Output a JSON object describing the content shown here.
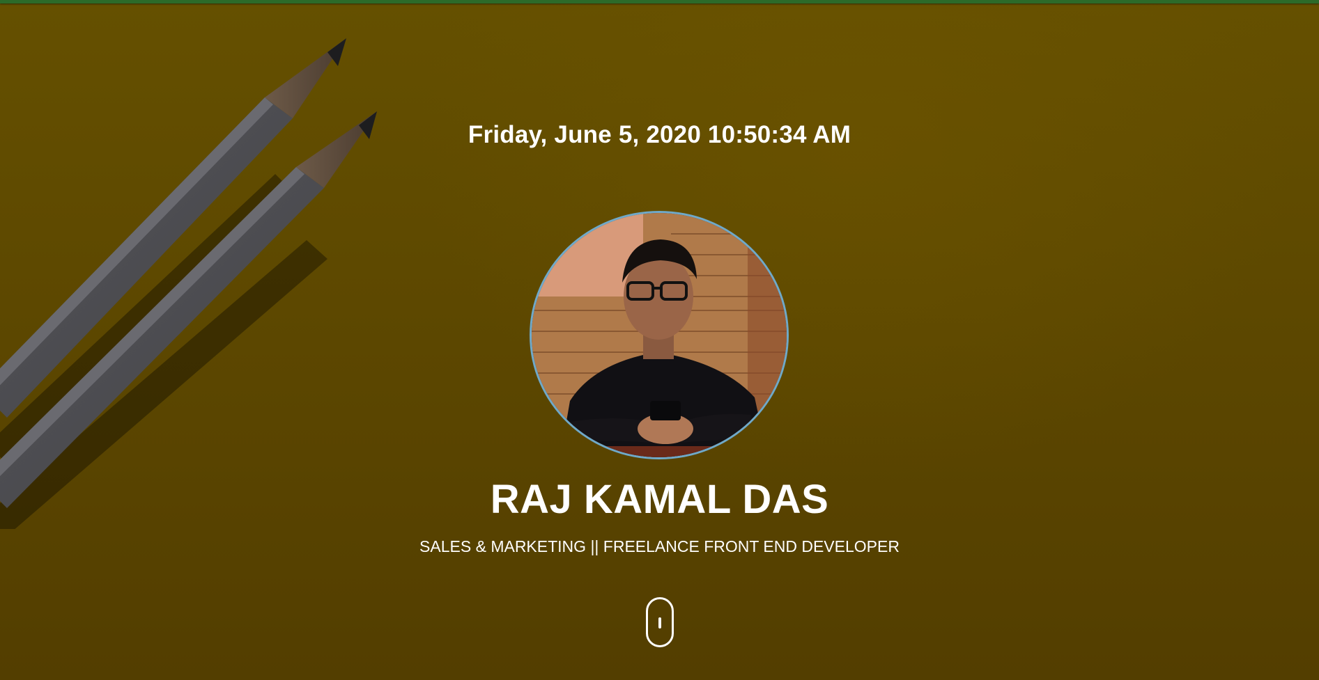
{
  "hero": {
    "datetime": "Friday, June 5, 2020 10:50:34 AM",
    "name": "RAJ KAMAL DAS",
    "tagline": "SALES & MARKETING || FREELANCE FRONT END DEVELOPER"
  },
  "colors": {
    "background": "#5a4500",
    "top_bar": "#2c6a2a",
    "avatar_border": "#6fa9c9",
    "text": "#ffffff"
  },
  "icons": {
    "scroll": "mouse-scroll-icon",
    "decor": "pencils-illustration"
  }
}
